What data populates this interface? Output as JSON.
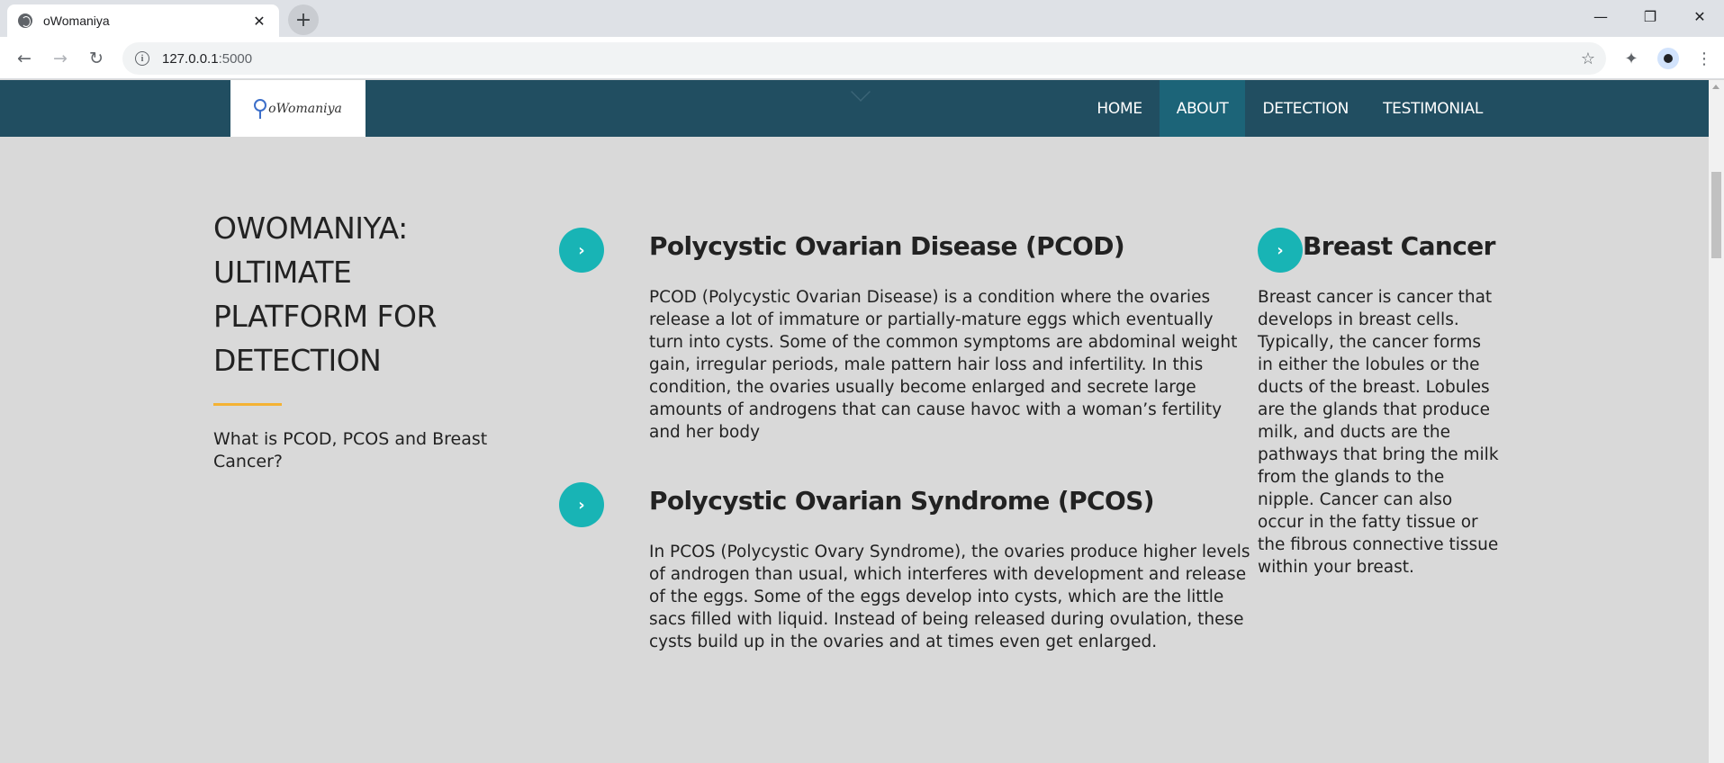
{
  "browser": {
    "tab_title": "oWomaniya",
    "tab_close": "✕",
    "new_tab": "+",
    "url_host": "127.0.0.1",
    "url_port": ":5000",
    "win_minimize": "—",
    "win_restore": "❐",
    "win_close": "✕"
  },
  "site": {
    "logo_text": "oWomaniya",
    "nav": [
      {
        "label": "HOME"
      },
      {
        "label": "ABOUT"
      },
      {
        "label": "DETECTION"
      },
      {
        "label": "TESTIMONIAL"
      }
    ],
    "active_nav": "ABOUT"
  },
  "hero": {
    "title": "OWOMANIYA: ULTIMATE PLATFORM FOR DETECTION",
    "subtitle": "What is PCOD, PCOS and Breast Cancer?"
  },
  "sections": [
    {
      "title": "Polycystic Ovarian Disease (PCOD)",
      "body": "PCOD (Polycystic Ovarian Disease) is a condition where the ovaries release a lot of immature or partially-mature eggs which eventually turn into cysts. Some of the common symptoms are abdominal weight gain, irregular periods, male pattern hair loss and infertility. In this condition, the ovaries usually become enlarged and secrete large amounts of androgens that can cause havoc with a woman’s fertility and her body"
    },
    {
      "title": "Polycystic Ovarian Syndrome (PCOS)",
      "body": "In PCOS (Polycystic Ovary Syndrome), the ovaries produce higher levels of androgen than usual, which interferes with development and release of the eggs. Some of the eggs develop into cysts, which are the little sacs filled with liquid. Instead of being released during ovulation, these cysts build up in the ovaries and at times even get enlarged."
    },
    {
      "title": "Breast Cancer",
      "body": "Breast cancer is cancer that develops in breast cells. Typically, the cancer forms in either the lobules or the ducts of the breast. Lobules are the glands that produce milk, and ducts are the pathways that bring the milk from the glands to the nipple. Cancer can also occur in the fatty tissue or the fibrous connective tissue within your breast."
    }
  ],
  "colors": {
    "nav_bg": "#214e61",
    "nav_active": "#1c6478",
    "accent_teal": "#18b4b5",
    "accent_rule": "#f4b233",
    "page_bg": "#d9d9d9"
  },
  "icons": {
    "back": "back-arrow-icon",
    "forward": "forward-arrow-icon",
    "reload": "reload-icon",
    "star": "star-icon",
    "extensions": "puzzle-icon",
    "profile": "avatar-icon",
    "menu": "kebab-menu-icon",
    "section_bullet": "chevron-right-icon"
  }
}
